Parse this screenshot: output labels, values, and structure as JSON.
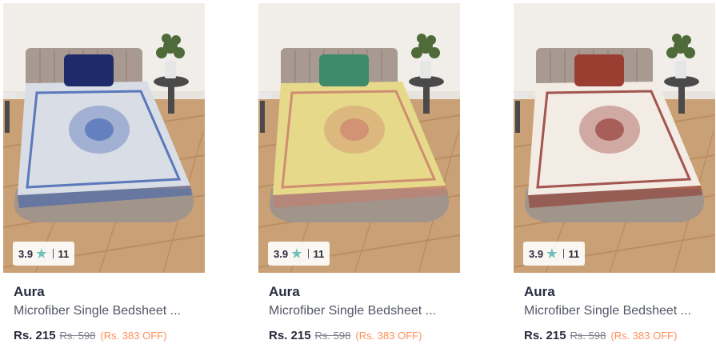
{
  "products": [
    {
      "brand": "Aura",
      "name": "Microfiber Single Bedsheet ...",
      "rating": "3.9",
      "reviews": "11",
      "price": "Rs. 215",
      "mrp": "Rs. 598",
      "discount": "(Rs. 383 OFF)",
      "pillow_color": "#1f2a6b",
      "sheet_color": "#d9dde6",
      "sheet_accent": "#3b5fb0",
      "image_icon": "bedsheet-image"
    },
    {
      "brand": "Aura",
      "name": "Microfiber Single Bedsheet ...",
      "rating": "3.9",
      "reviews": "11",
      "price": "Rs. 215",
      "mrp": "Rs. 598",
      "discount": "(Rs. 383 OFF)",
      "pillow_color": "#3f8a6a",
      "sheet_color": "#e6d98a",
      "sheet_accent": "#c97a6a",
      "image_icon": "bedsheet-image"
    },
    {
      "brand": "Aura",
      "name": "Microfiber Single Bedsheet ...",
      "rating": "3.9",
      "reviews": "11",
      "price": "Rs. 215",
      "mrp": "Rs. 598",
      "discount": "(Rs. 383 OFF)",
      "pillow_color": "#9a3e32",
      "sheet_color": "#f3ece4",
      "sheet_accent": "#8e2f2a",
      "image_icon": "bedsheet-image"
    }
  ],
  "colors": {
    "star": "#72bfbc",
    "discount": "#ff905a",
    "text_primary": "#282c3f",
    "text_secondary": "#535766"
  }
}
